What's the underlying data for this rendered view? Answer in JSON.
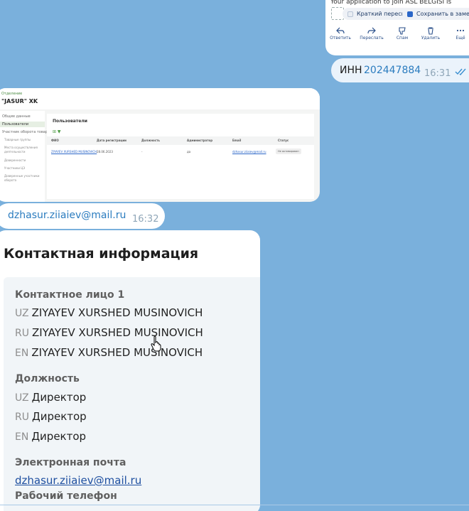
{
  "mail_preview": {
    "text": "Your application to join ASL BELGISI is",
    "chips": [
      {
        "label": "Краткий пересказ",
        "icon": "summary-icon"
      },
      {
        "label": "Сохранить в заметк",
        "icon": "note-icon"
      }
    ],
    "actions": [
      {
        "label": "Ответить",
        "icon": "reply-icon"
      },
      {
        "label": "Переслать",
        "icon": "forward-icon"
      },
      {
        "label": "Спам",
        "icon": "spam-icon"
      },
      {
        "label": "Удалить",
        "icon": "trash-icon"
      },
      {
        "label": "Ещё",
        "icon": "more-icon"
      }
    ]
  },
  "inn_message": {
    "label": "ИНН",
    "value": "202447884",
    "time": "16:31",
    "status_icon": "double-check-icon"
  },
  "users_screenshot": {
    "link": "Отделение",
    "company": "\"JASUR\" XK",
    "sidebar": [
      "Общие данные",
      "Пользователи",
      "Участник оборота товаров"
    ],
    "sidebar_sub": [
      "Товарные группы",
      "Места осуществления деятельности",
      "Доверенности",
      "Участники ЦЭ",
      "Доверенные участники оборота"
    ],
    "title": "Пользователи",
    "filter": "⊞ ▼",
    "columns": [
      "ФИО",
      "Дата регистрации",
      "Должность",
      "Администратор",
      "Email",
      "Статус"
    ],
    "row": [
      "ZIYAYEV XURSHED MUSINOVICH",
      "28.06.2023",
      "-",
      "да",
      "dzhasur.ziiaiev@mail.ru",
      "Не активирован"
    ]
  },
  "email_message": {
    "text": "dzhasur.ziiaiev@mail.ru",
    "time": "16:32"
  },
  "contact_info": {
    "heading": "Контактная информация",
    "person_label": "Контактное лицо 1",
    "person": [
      {
        "code": "UZ",
        "value": "ZIYAYEV XURSHED MUSINOVICH"
      },
      {
        "code": "RU",
        "value": "ZIYAYEV XURSHED MUSINOVICH"
      },
      {
        "code": "EN",
        "value": "ZIYAYEV XURSHED MUSINOVICH"
      }
    ],
    "position_label": "Должность",
    "position": [
      {
        "code": "UZ",
        "value": "Директор"
      },
      {
        "code": "RU",
        "value": "Директор"
      },
      {
        "code": "EN",
        "value": "Директор"
      }
    ],
    "email_label": "Электронная почта",
    "email": "dzhasur.ziiaiev@mail.ru",
    "phone_label": "Рабочий телефон"
  },
  "colors": {
    "chat_background": "#7ab0dc",
    "incoming_bubble": "#ffffff",
    "outgoing_bubble": "#ebf3fb",
    "link": "#2b7cbf"
  }
}
